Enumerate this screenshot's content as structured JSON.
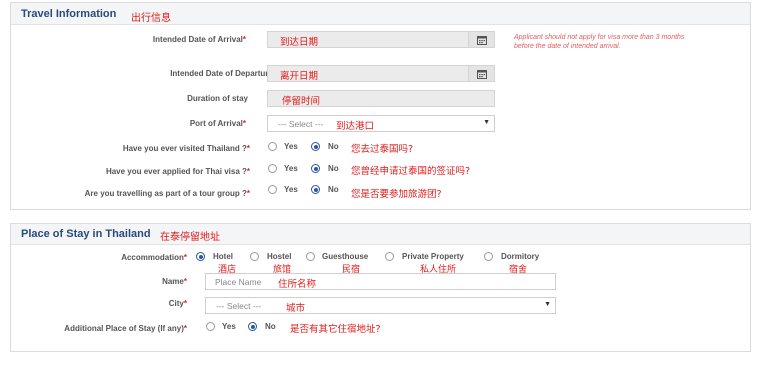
{
  "travel": {
    "title": "Travel Information",
    "title_cn": "出行信息",
    "arrival": {
      "label": "Intended Date of Arrival",
      "cn": "到达日期"
    },
    "departure": {
      "label": "Intended Date of Departure",
      "cn": "离开日期"
    },
    "duration": {
      "label": "Duration of stay",
      "cn": "停留时间"
    },
    "port": {
      "label": "Port of Arrival",
      "value": "--- Select ---",
      "cn": "到达港口"
    },
    "visited": {
      "label": "Have you ever visited Thailand ?",
      "yes": "Yes",
      "no": "No",
      "selected": "No",
      "cn": "您去过泰国吗?"
    },
    "applied": {
      "label": "Have you ever applied for Thai visa ?",
      "yes": "Yes",
      "no": "No",
      "selected": "No",
      "cn": "您曾经申请过泰国的签证吗?"
    },
    "tour": {
      "label": "Are you travelling as part of a tour group ?",
      "yes": "Yes",
      "no": "No",
      "selected": "No",
      "cn": "您是否要参加旅游团?"
    },
    "note_line1": "Applicant should not apply for visa more than 3 months",
    "note_line2": "before the date of intended arrival."
  },
  "stay": {
    "title": "Place of Stay in Thailand",
    "title_cn": "在泰停留地址",
    "accommodation_label": "Accommodation",
    "options": [
      {
        "label": "Hotel",
        "cn": "酒店",
        "selected": true
      },
      {
        "label": "Hostel",
        "cn": "旅馆",
        "selected": false
      },
      {
        "label": "Guesthouse",
        "cn": "民宿",
        "selected": false
      },
      {
        "label": "Private Property",
        "cn": "私人住所",
        "selected": false
      },
      {
        "label": "Dormitory",
        "cn": "宿舍",
        "selected": false
      }
    ],
    "name_label": "Name",
    "name_placeholder": "Place Name",
    "name_cn": "住所名称",
    "city_label": "City",
    "city_value": "--- Select ---",
    "city_cn": "城市",
    "additional_label": "Additional Place of Stay (If any)",
    "additional_yes": "Yes",
    "additional_no": "No",
    "additional_selected": "No",
    "additional_cn": "是否有其它住宿地址?"
  },
  "required_mark": "*"
}
